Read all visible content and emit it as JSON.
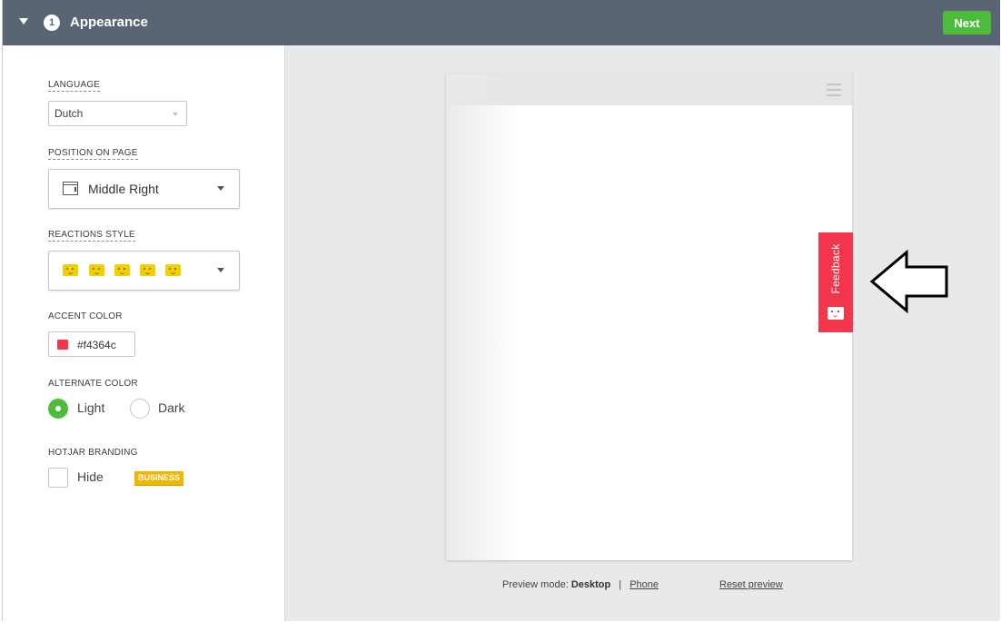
{
  "header": {
    "step_number": "1",
    "title": "Appearance",
    "next_label": "Next"
  },
  "settings": {
    "language": {
      "label": "LANGUAGE",
      "value": "Dutch"
    },
    "position": {
      "label": "POSITION ON PAGE",
      "value": "Middle Right"
    },
    "reactions": {
      "label": "REACTIONS STYLE",
      "faces": [
        "hate-face-icon",
        "dislike-face-icon",
        "neutral-face-icon",
        "like-face-icon",
        "love-face-icon"
      ]
    },
    "accent": {
      "label": "ACCENT COLOR",
      "value": "#f4364c",
      "swatch_color": "#f4364c"
    },
    "alternate": {
      "label": "ALTERNATE COLOR",
      "options": [
        "Light",
        "Dark"
      ],
      "selected": "Light"
    },
    "branding": {
      "label": "HOTJAR BRANDING",
      "checkbox_label": "Hide",
      "badge": "BUSINESS",
      "checked": false
    }
  },
  "preview": {
    "feedback_tab_label": "Feedback",
    "tab_color": "#f4364c",
    "mode_label": "Preview mode:",
    "mode_selected": "Desktop",
    "mode_other": "Phone",
    "separator": "|",
    "reset_label": "Reset preview"
  }
}
